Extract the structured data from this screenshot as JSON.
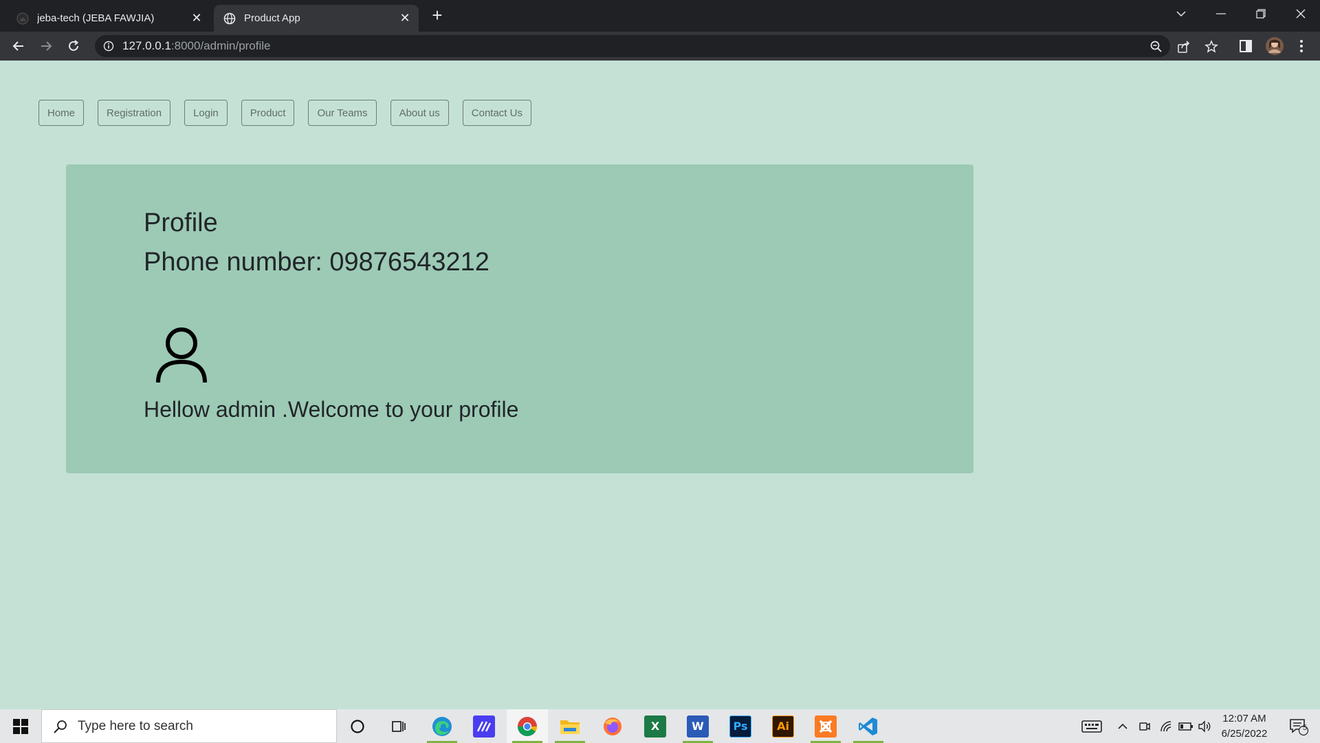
{
  "browser": {
    "tabs": [
      {
        "title": "jeba-tech (JEBA FAWJIA)",
        "favicon": "github-icon",
        "active": false
      },
      {
        "title": "Product App",
        "favicon": "globe-icon",
        "active": true
      }
    ],
    "new_tab_label": "+",
    "url_host": "127.0.0.1",
    "url_path": ":8000/admin/profile"
  },
  "nav": {
    "items": [
      "Home",
      "Registration",
      "Login",
      "Product",
      "Our Teams",
      "About us",
      "Contact Us"
    ]
  },
  "profile": {
    "title": "Profile",
    "phone": "Phone number: 09876543212",
    "avatar_icon": "user-icon",
    "welcome": "Hellow admin .Welcome to your profile"
  },
  "taskbar": {
    "search_placeholder": "Type here to search",
    "apps": [
      {
        "name": "cortana",
        "icon": "cortana-icon"
      },
      {
        "name": "task-view",
        "icon": "task-view-icon"
      },
      {
        "name": "edge",
        "icon": "edge-icon",
        "running": true
      },
      {
        "name": "pen-app",
        "icon": "pen-app-icon"
      },
      {
        "name": "chrome",
        "icon": "chrome-icon",
        "running": true,
        "focused": true
      },
      {
        "name": "file-explorer",
        "icon": "folder-icon",
        "running": true
      },
      {
        "name": "firefox",
        "icon": "firefox-icon"
      },
      {
        "name": "excel",
        "icon": "excel-icon",
        "label": "X"
      },
      {
        "name": "word",
        "icon": "word-icon",
        "label": "W",
        "running": true
      },
      {
        "name": "photoshop",
        "icon": "photoshop-icon",
        "label": "Ps"
      },
      {
        "name": "illustrator",
        "icon": "illustrator-icon",
        "label": "Ai"
      },
      {
        "name": "xampp",
        "icon": "xampp-icon",
        "running": true
      },
      {
        "name": "vscode",
        "icon": "vscode-icon",
        "running": true
      }
    ],
    "time": "12:07 AM",
    "date": "6/25/2022",
    "notification_count": "5"
  },
  "colors": {
    "page_bg": "#c5e1d6",
    "card_bg": "#9ccab5",
    "chrome_dark": "#202124",
    "chrome_toolbar": "#35363a"
  }
}
